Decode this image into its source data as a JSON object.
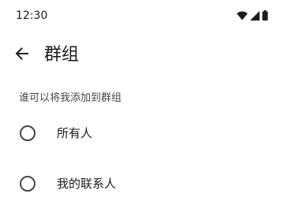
{
  "status_bar": {
    "time": "12:30",
    "icons": [
      "wifi-icon",
      "cellular-signal-icon",
      "battery-icon"
    ]
  },
  "app_bar": {
    "back_icon": "arrow-back-icon",
    "title": "群组"
  },
  "section": {
    "label": "谁可以将我添加到群组"
  },
  "options": [
    {
      "label": "所有人",
      "selected": false
    },
    {
      "label": "我的联系人",
      "selected": false
    }
  ],
  "colors": {
    "background": "#ffffff",
    "text_primary": "#1c1b1f",
    "text_secondary": "#444746"
  }
}
